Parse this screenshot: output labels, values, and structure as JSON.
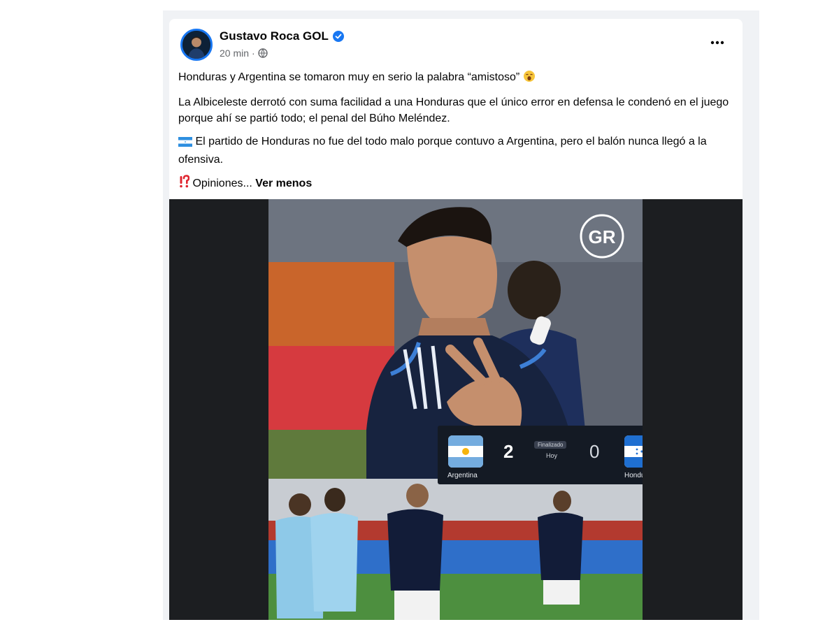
{
  "post": {
    "author": "Gustavo Roca GOL",
    "time": "20 min",
    "time_separator": "·",
    "paragraphs": [
      "Honduras y Argentina se tomaron muy en serio la palabra “amistoso”",
      "La Albiceleste derrotó con suma facilidad a una Honduras que el único error en defensa le condenó en el juego porque ahí se partió todo; el penal del Búho Meléndez.",
      "El partido de Honduras no fue del todo malo porque contuvo a Argentina, pero el balón nunca llegó a la ofensiva.",
      "Opiniones..."
    ],
    "see_less": "Ver menos"
  },
  "icons": {
    "verified": "verified-badge-icon",
    "audience": "globe-icon",
    "more": "more-options-icon",
    "emoji_1": "yawning-face-emoji",
    "emoji_2": "honduras-flag-emoji",
    "emoji_3": "exclamation-question-emoji"
  },
  "image": {
    "watermark": "GR",
    "scoreboard": {
      "home_team": "Argentina",
      "away_team": "Honduras",
      "home_score": "2",
      "away_score": "0",
      "status": "Finalizado",
      "date": "Hoy"
    }
  },
  "colors": {
    "brand_blue": "#1877f2",
    "text": "#050505",
    "secondary_text": "#65676b",
    "media_background": "#1c1e21"
  }
}
